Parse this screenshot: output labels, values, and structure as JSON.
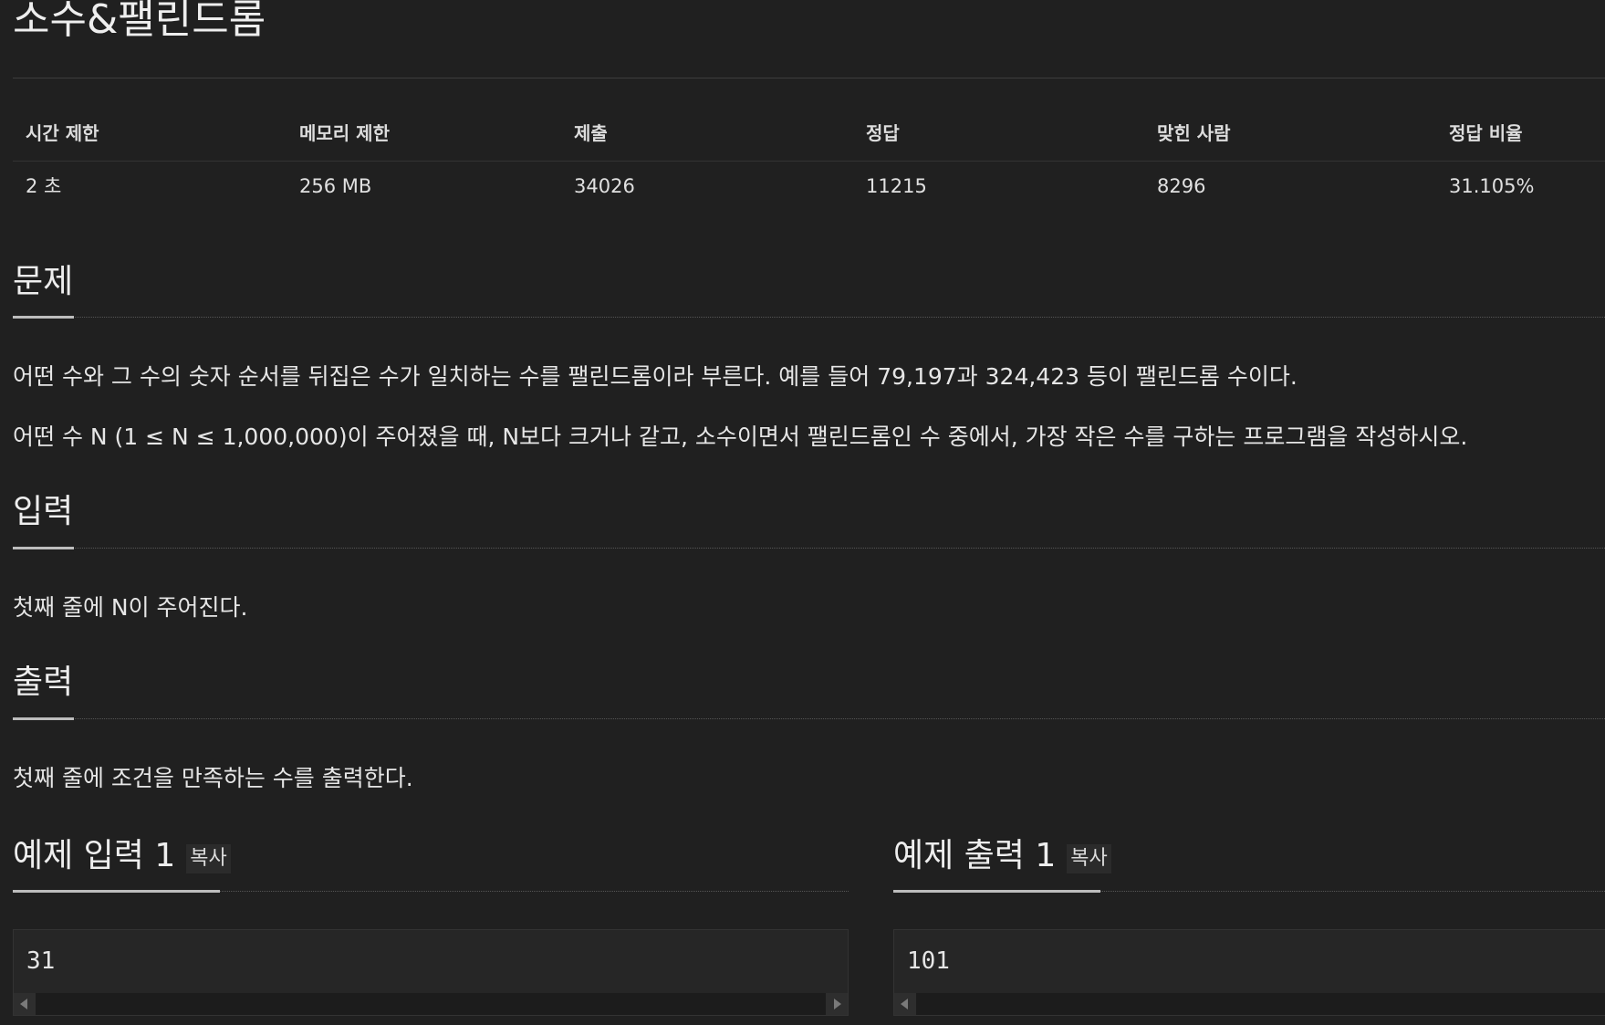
{
  "problem": {
    "title": "소수&팰린드롬"
  },
  "info_table": {
    "headers": [
      "시간 제한",
      "메모리 제한",
      "제출",
      "정답",
      "맞힌 사람",
      "정답 비율"
    ],
    "values": [
      "2 초",
      "256 MB",
      "34026",
      "11215",
      "8296",
      "31.105%"
    ]
  },
  "sections": {
    "problem": {
      "heading": "문제",
      "paragraphs": [
        "어떤 수와 그 수의 숫자 순서를 뒤집은 수가 일치하는 수를 팰린드롬이라 부른다. 예를 들어 79,197과 324,423 등이 팰린드롬 수이다.",
        "어떤 수 N (1 ≤ N ≤ 1,000,000)이 주어졌을 때, N보다 크거나 같고, 소수이면서 팰린드롬인 수 중에서, 가장 작은 수를 구하는 프로그램을 작성하시오."
      ]
    },
    "input": {
      "heading": "입력",
      "paragraphs": [
        "첫째 줄에 N이 주어진다."
      ]
    },
    "output": {
      "heading": "출력",
      "paragraphs": [
        "첫째 줄에 조건을 만족하는 수를 출력한다."
      ]
    }
  },
  "samples": {
    "input": {
      "heading": "예제 입력 1",
      "copy_label": "복사",
      "value": "31"
    },
    "output": {
      "heading": "예제 출력 1",
      "copy_label": "복사",
      "value": "101"
    }
  },
  "colors": {
    "background": "#202020",
    "text": "#e6e6e6",
    "underline": "#bdbdbd",
    "code_background": "#262626"
  }
}
